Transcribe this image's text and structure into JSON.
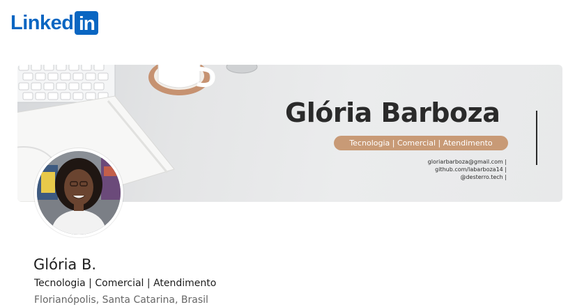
{
  "header": {
    "logo_word": "Linked",
    "logo_box": "in"
  },
  "banner": {
    "name": "Glória Barboza",
    "tagline": "Tecnologia | Comercial | Atendimento",
    "contacts": [
      "gloriarbarboza@gmail.com |",
      "github.com/labarboza14 |",
      "@desterro.tech |"
    ]
  },
  "profile": {
    "name": "Glória B.",
    "headline": "Tecnologia | Comercial | Atendimento",
    "location": "Florianópolis, Santa Catarina, Brasil"
  },
  "colors": {
    "brand": "#0a66c2",
    "pill": "#c89a76"
  }
}
